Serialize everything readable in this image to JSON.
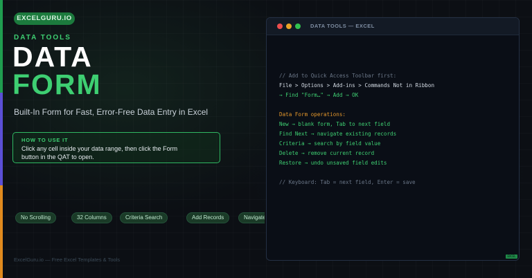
{
  "brand": {
    "pill_label": "EXCELGURU.IO"
  },
  "hero": {
    "kicker": "DATA TOOLS",
    "title_line1": "DATA",
    "title_line2": "FORM",
    "subtitle": "Built-In Form for Fast, Error-Free Data Entry in Excel"
  },
  "howto": {
    "title": "HOW TO USE IT",
    "text": "Click any cell inside your data range, then click the Form button in the QAT to open."
  },
  "tags": [
    "No Scrolling",
    "32 Columns",
    "Criteria Search",
    "Add Records",
    "Navigate"
  ],
  "footer": {
    "text": "ExcelGuru.io — Free Excel Templates & Tools"
  },
  "code_window": {
    "title": "DATA TOOLS — EXCEL",
    "lines": [
      {
        "text": "// Add to Quick Access Toolbar first:",
        "style": "comment"
      },
      {
        "text": "File > Options > Add-ins > Commands Not in Ribbon",
        "style": "white"
      },
      {
        "text": "→ Find \"Form…\" → Add → OK",
        "style": "green"
      },
      {
        "text": "",
        "style": "white"
      },
      {
        "text": "Data Form operations:",
        "style": "orange"
      },
      {
        "text": "New → blank form, Tab to next field",
        "style": "green"
      },
      {
        "text": "Find Next → navigate existing records",
        "style": "green"
      },
      {
        "text": "Criteria → search by field value",
        "style": "green"
      },
      {
        "text": "Delete → remove current record",
        "style": "green"
      },
      {
        "text": "Restore → undo unsaved field edits",
        "style": "green"
      },
      {
        "text": "",
        "style": "white"
      },
      {
        "text": "// Keyboard: Tab = next field, Enter = save",
        "style": "comment"
      }
    ],
    "corner_badge": "EXCEL"
  },
  "colors": {
    "accent_green": "#3ecf72",
    "accent_purple": "#5b4fd6",
    "accent_orange": "#e08a1e",
    "background": "#0c0f14"
  },
  "icons": [
    "window-close-dot",
    "window-minimize-dot",
    "window-maximize-dot"
  ]
}
